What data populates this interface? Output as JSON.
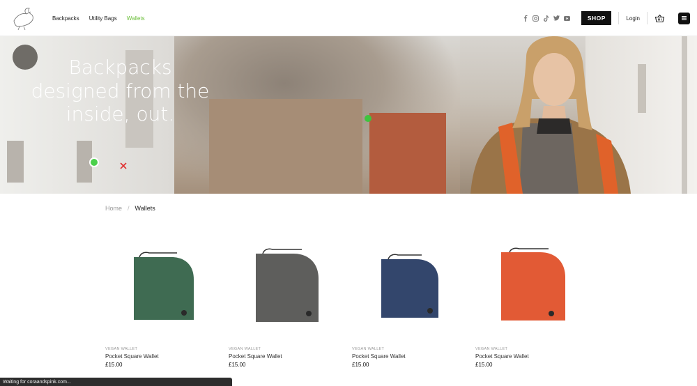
{
  "header": {
    "nav": [
      "Backpacks",
      "Utility Bags",
      "Wallets"
    ],
    "active_nav": "Wallets",
    "socials": [
      "facebook-icon",
      "instagram-icon",
      "tiktok-icon",
      "twitter-icon",
      "youtube-icon"
    ],
    "shop_label": "SHOP",
    "login_label": "Login"
  },
  "hero": {
    "title_lines": [
      "Backpacks",
      "designed from the",
      "inside, out."
    ]
  },
  "breadcrumb": {
    "home": "Home",
    "separator": "/",
    "current": "Wallets"
  },
  "products": [
    {
      "category": "VEGAN WALLET",
      "name": "Pocket Square Wallet",
      "price": "£15.00",
      "color": "#3f6b52"
    },
    {
      "category": "VEGAN WALLET",
      "name": "Pocket Square Wallet",
      "price": "£15.00",
      "color": "#5e5e5c"
    },
    {
      "category": "VEGAN WALLET",
      "name": "Pocket Square Wallet",
      "price": "£15.00",
      "color": "#33466c"
    },
    {
      "category": "VEGAN WALLET",
      "name": "Pocket Square Wallet",
      "price": "£15.00",
      "color": "#e25a35"
    }
  ],
  "status_bar": "Waiting for coraandspink.com...",
  "colors": {
    "accent": "#6bbf3a",
    "dark": "#111111"
  }
}
